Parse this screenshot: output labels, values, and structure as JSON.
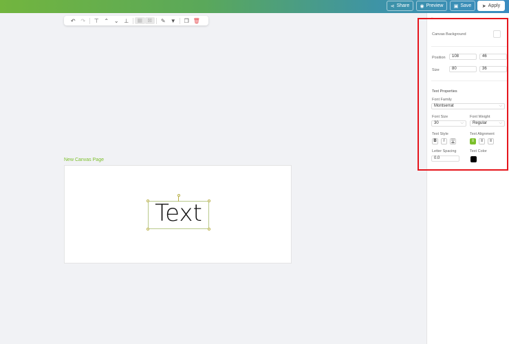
{
  "header": {
    "share": "Share",
    "preview": "Preview",
    "save": "Save",
    "apply": "Apply"
  },
  "toolbar": {
    "icons": [
      "undo-icon",
      "redo-icon",
      "text-top-icon",
      "bring-forward-icon",
      "send-backward-icon",
      "align-bottom-icon",
      "group-icon",
      "ungroup-icon",
      "pen-icon",
      "fill-icon",
      "copy-icon",
      "delete-icon"
    ]
  },
  "canvas": {
    "page_label": "New Canvas Page",
    "text": "Text"
  },
  "panel": {
    "collapse": "»",
    "canvas_background": "Canvas Background",
    "position_label": "Position",
    "position_x": "108",
    "position_y": "46",
    "size_label": "Size",
    "size_w": "80",
    "size_h": "36",
    "text_properties": "Text Properties",
    "font_family_label": "Font Family",
    "font_family": "Montserrat",
    "font_size_label": "Font Size",
    "font_size": "30",
    "font_weight_label": "Font Weight",
    "font_weight": "Regular",
    "text_style_label": "Text Style",
    "bold": "B",
    "italic": "I",
    "underline": "U",
    "text_alignment_label": "Text Alignment",
    "letter_spacing_label": "Letter Spacing",
    "letter_spacing": "0.0",
    "text_color_label": "Text Color",
    "text_color": "#000000"
  },
  "colors": {
    "accent": "#7bbf2a",
    "highlight": "#e5141b"
  }
}
